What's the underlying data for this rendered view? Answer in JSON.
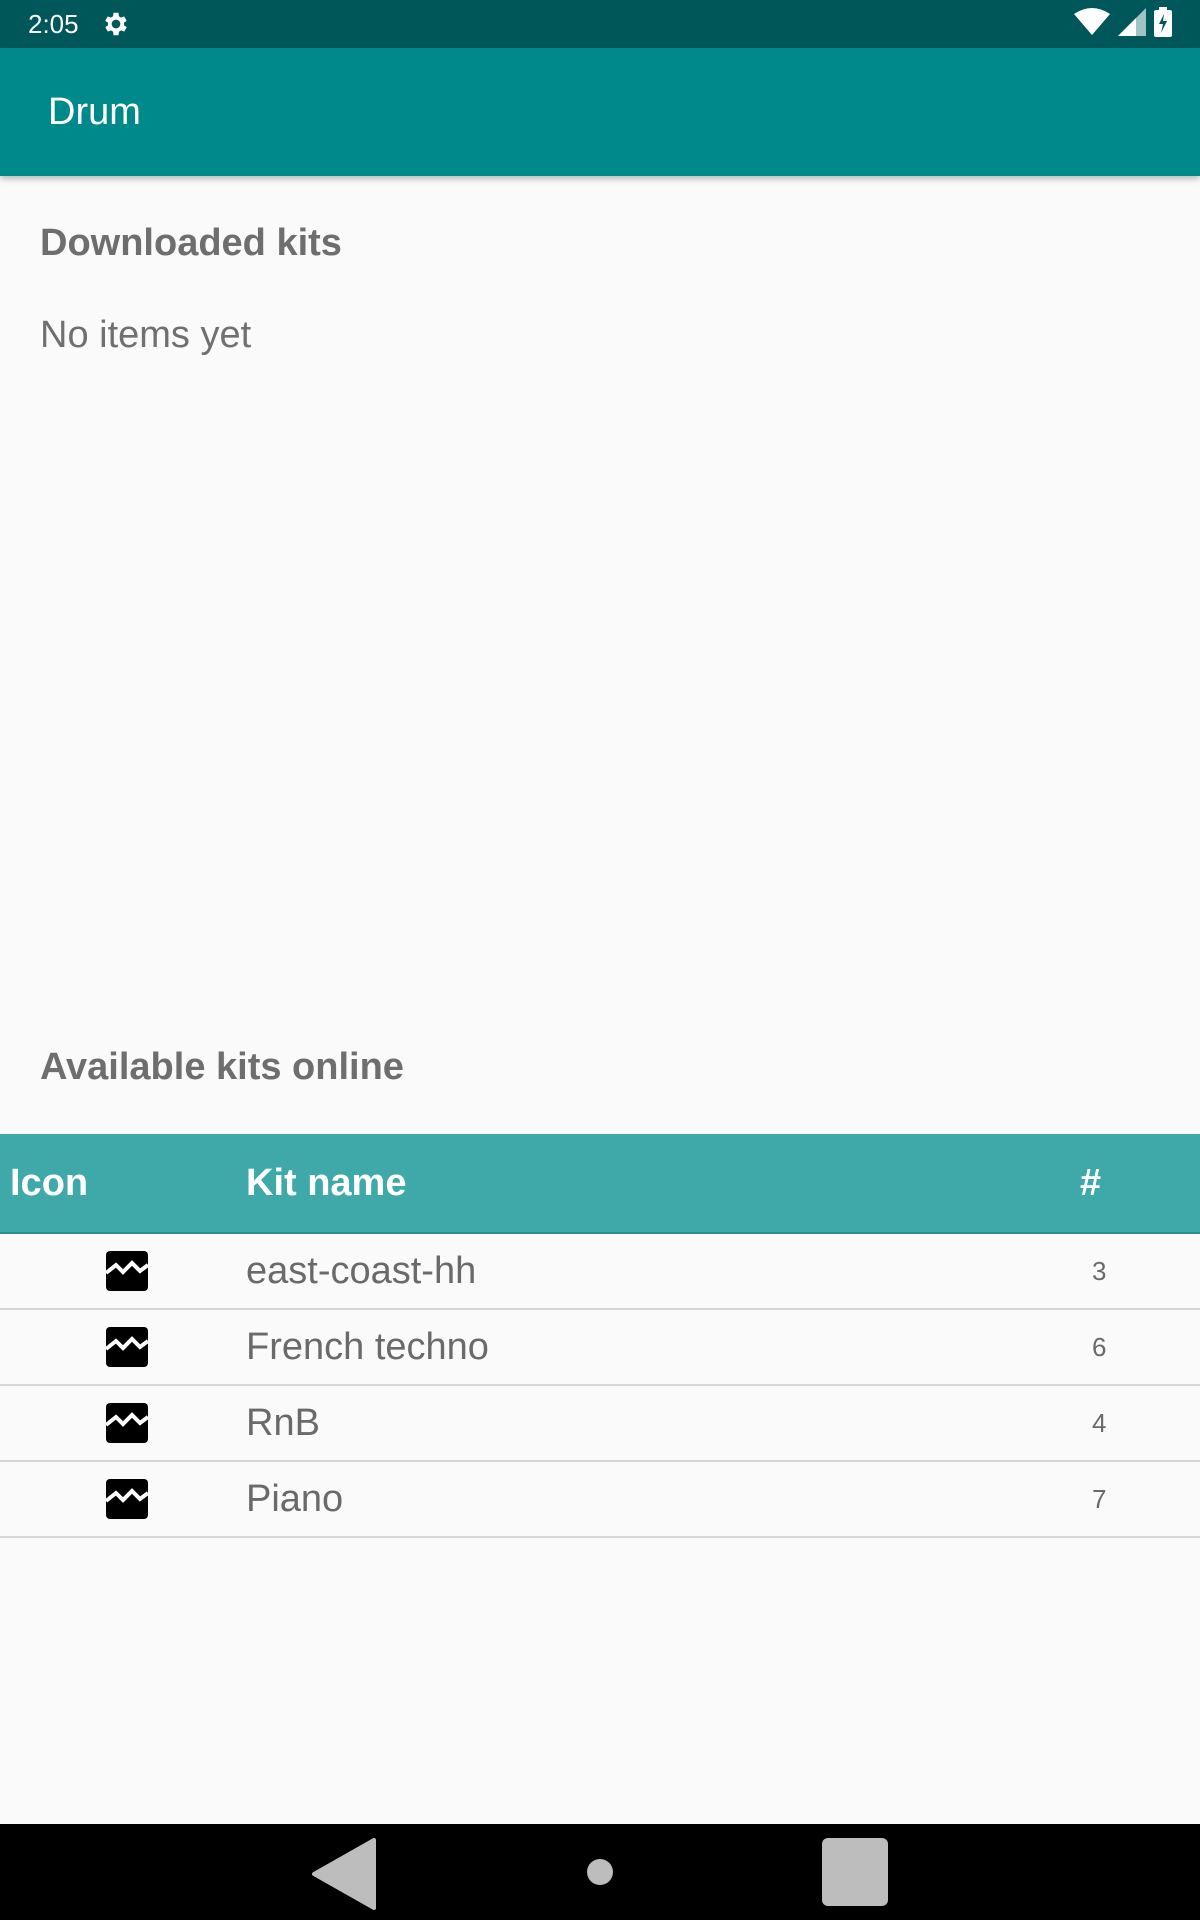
{
  "status_bar": {
    "time": "2:05"
  },
  "app_bar": {
    "title": "Drum"
  },
  "downloaded": {
    "title": "Downloaded kits",
    "empty_text": "No items yet"
  },
  "available": {
    "title": "Available kits online",
    "columns": {
      "icon": "Icon",
      "name": "Kit name",
      "count": "#"
    },
    "kits": [
      {
        "name": "east-coast-hh",
        "count": "3",
        "icon": "waveform-icon"
      },
      {
        "name": "French techno",
        "count": "6",
        "icon": "waveform-icon"
      },
      {
        "name": "RnB",
        "count": "4",
        "icon": "waveform-icon"
      },
      {
        "name": "Piano",
        "count": "7",
        "icon": "waveform-icon"
      }
    ]
  },
  "colors": {
    "status_bar": "#00575a",
    "app_bar": "#00898a",
    "table_header": "#3fa9a9",
    "background": "#fafafa"
  }
}
